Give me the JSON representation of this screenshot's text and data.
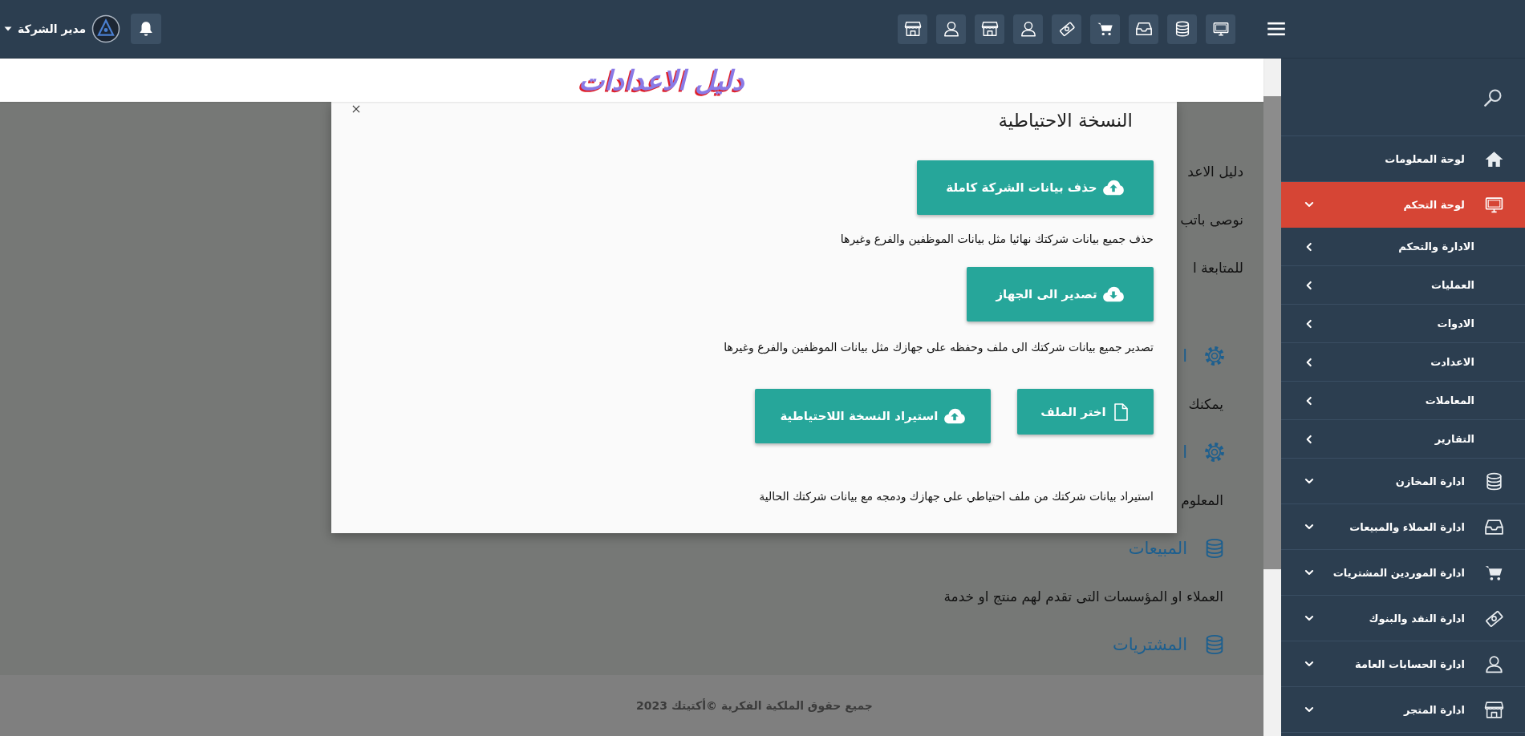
{
  "topbar": {
    "user_name": "مدير الشركة"
  },
  "header": {
    "title": "دليل الاعدادات"
  },
  "background_content": [
    {
      "kind": "lead",
      "text": "دليل الاعد"
    },
    {
      "kind": "lead",
      "text": "نوصى باتب"
    },
    {
      "kind": "lead",
      "text": "للمتابعة ا"
    },
    {
      "kind": "gear-heading",
      "text": "ا"
    },
    {
      "kind": "body",
      "text": "يمكنك"
    },
    {
      "kind": "gear-heading",
      "text": "ا"
    },
    {
      "kind": "body",
      "text": "المعلوم"
    },
    {
      "kind": "database-heading",
      "text": "المبيعات"
    },
    {
      "kind": "body",
      "text": "العملاء او المؤسسات التى تقدم لهم منتج او خدمة"
    },
    {
      "kind": "database-heading",
      "text": "المشتريات"
    }
  ],
  "modal": {
    "title": "النسخة الاحتياطية",
    "sections": [
      {
        "buttons": [
          {
            "kind": "upload",
            "label": "حذف بيانات الشركة كاملة"
          }
        ],
        "description": "حذف جميع بيانات شركتك نهائيا مثل بيانات الموظفين والفرع وغيرها"
      },
      {
        "buttons": [
          {
            "kind": "download",
            "label": "تصدير الى الجهاز"
          }
        ],
        "description": "تصدير جميع بيانات شركتك الى ملف وحفظه على جهازك مثل بيانات الموظفين والفرع وغيرها"
      },
      {
        "buttons": [
          {
            "kind": "file",
            "label": "اختر الملف"
          },
          {
            "kind": "upload",
            "label": "استيراد النسخة اللاحتياطية"
          }
        ],
        "description": "استيراد بيانات شركتك من ملف احتياطي على جهازك ودمجه مع بيانات شركتك الحالية"
      }
    ]
  },
  "sidebar": {
    "items": [
      {
        "kind": "link",
        "label": "لوحة المعلومات",
        "selected": false
      },
      {
        "kind": "menu",
        "label": "لوحة التحكم",
        "selected": true,
        "children": [
          {
            "label": "الادارة والتحكم"
          },
          {
            "label": "العمليات"
          },
          {
            "label": "الادوات"
          },
          {
            "label": "الاعدادت"
          },
          {
            "label": "المعاملات"
          },
          {
            "label": "التقارير"
          }
        ]
      },
      {
        "kind": "menu",
        "label": "ادارة المخازن",
        "selected": false
      },
      {
        "kind": "menu",
        "label": "ادارة العملاء والمبيعات",
        "selected": false
      },
      {
        "kind": "menu",
        "label": "ادارة الموردين المشتريات",
        "selected": false
      },
      {
        "kind": "menu",
        "label": "ادارة النقد والبنوك",
        "selected": false
      },
      {
        "kind": "menu",
        "label": "ادارة الحسابات العامة",
        "selected": false
      },
      {
        "kind": "menu",
        "label": "ادارة المتجر",
        "selected": false
      }
    ]
  },
  "footer": {
    "text": "جميع حقوق الملكية الفكرية ©أكتيتك 2023"
  }
}
